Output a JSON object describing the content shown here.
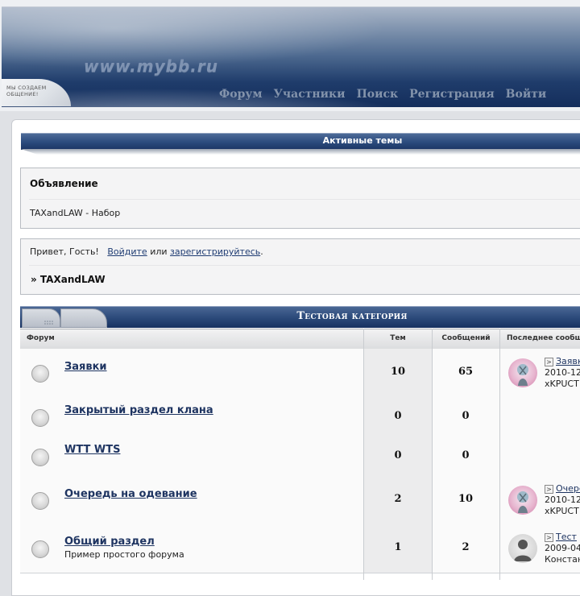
{
  "header": {
    "site_url": "www.mybb.ru",
    "tagline": "МЫ СОЗДАЕМ ОБЩЕНИЕ!",
    "nav": [
      "Форум",
      "Участники",
      "Поиск",
      "Регистрация",
      "Войти"
    ]
  },
  "active_topics": "Активные темы",
  "announcement": {
    "title": "Объявление",
    "text": "TAXandLAW - Набор"
  },
  "welcome": {
    "greeting": "Привет, Гость!",
    "login_link": "Войдите",
    "or": "или",
    "register_link": "зарегистрируйтесь",
    "period": ".",
    "breadcrumb": "» TAXandLAW"
  },
  "category": {
    "title": "Тестовая категория",
    "columns": {
      "forum": "Форум",
      "topics": "Тем",
      "posts": "Сообщений",
      "last_post": "Последнее сообщение"
    },
    "forums": [
      {
        "name": "Заявки",
        "description": "",
        "topics": "10",
        "posts": "65",
        "last_topic": "Заявки",
        "last_date": "2010-12",
        "last_author": "xKPUCT",
        "avatar": "pink"
      },
      {
        "name": "Закрытый раздел клана",
        "description": "",
        "topics": "0",
        "posts": "0",
        "last_topic": "",
        "last_date": "",
        "last_author": "",
        "avatar": ""
      },
      {
        "name": "WTT WTS",
        "description": "",
        "topics": "0",
        "posts": "0",
        "last_topic": "",
        "last_date": "",
        "last_author": "",
        "avatar": ""
      },
      {
        "name": "Очередь на одевание",
        "description": "",
        "topics": "2",
        "posts": "10",
        "last_topic": "Очередь",
        "last_date": "2010-12",
        "last_author": "xKPUCT",
        "avatar": "pink"
      },
      {
        "name": "Общий раздел",
        "description": "Пример простого форума",
        "topics": "1",
        "posts": "2",
        "last_topic": "Тест",
        "last_date": "2009-04",
        "last_author": "Констан",
        "avatar": "gray"
      }
    ]
  },
  "colors": {
    "header_dark": "#142e5c",
    "bar_blue": "#2a4879",
    "link": "#1e3461"
  }
}
